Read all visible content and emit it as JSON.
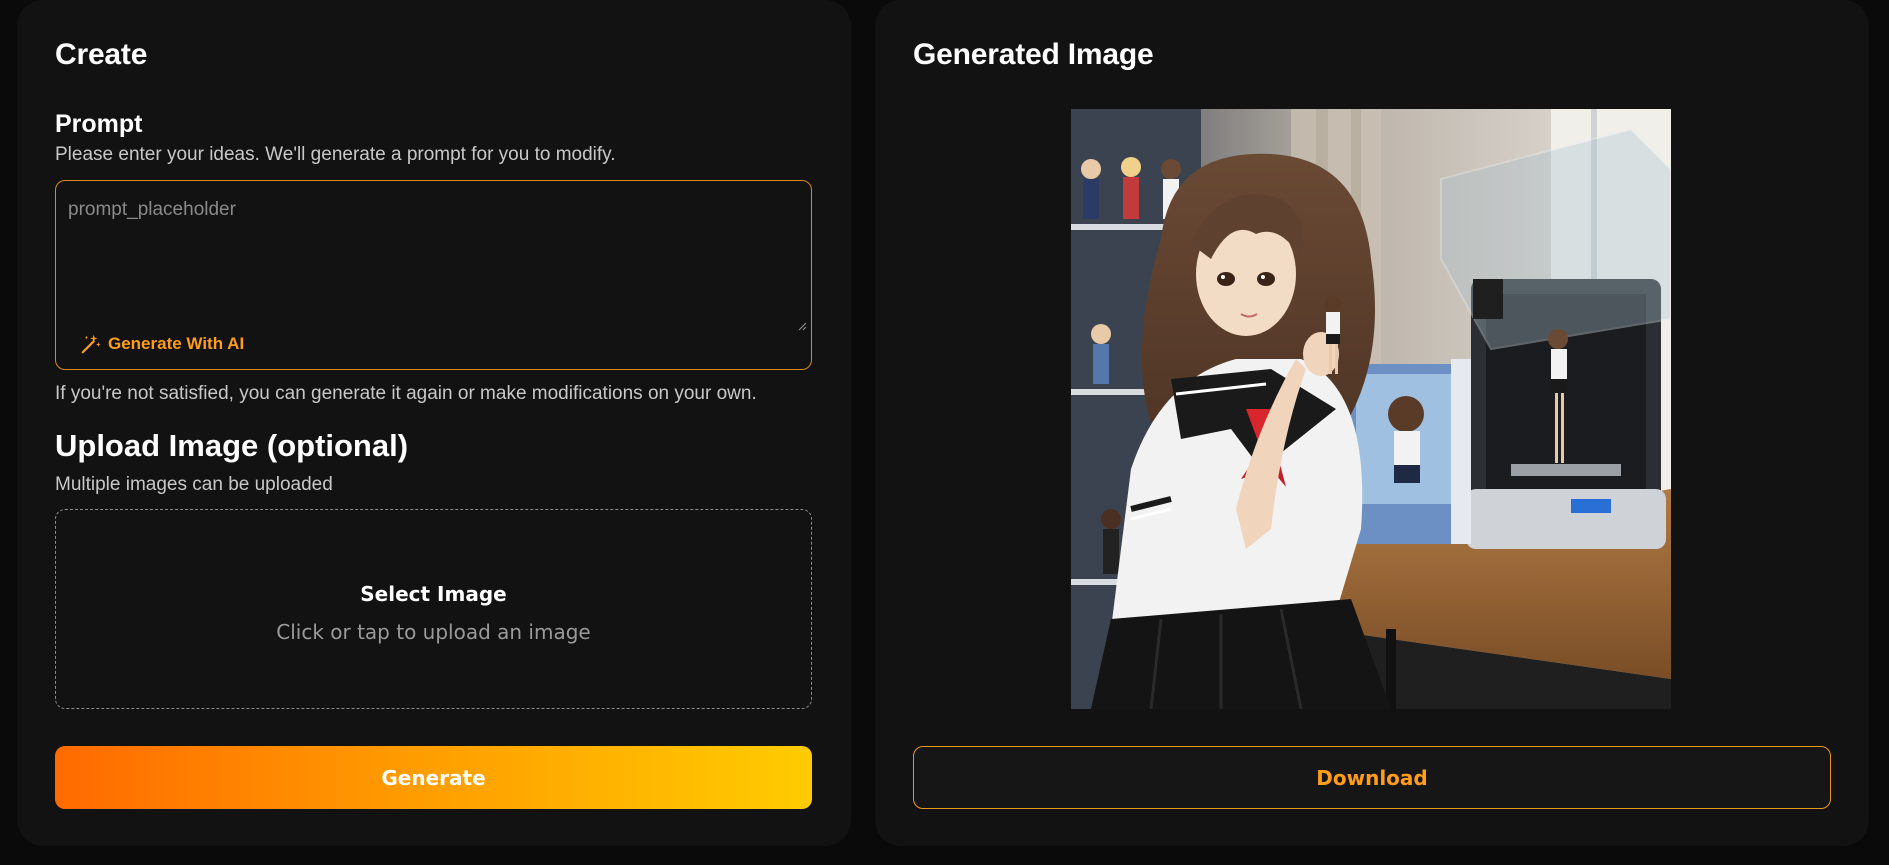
{
  "create_panel": {
    "title": "Create",
    "prompt": {
      "title": "Prompt",
      "hint": "Please enter your ideas. We'll generate a prompt for you to modify.",
      "placeholder": "prompt_placeholder",
      "value": "",
      "ai_button_label": "Generate With AI",
      "ai_button_icon": "magic-wand-icon",
      "after_hint": "If you're not satisfied, you can generate it again or make modifications on your own."
    },
    "upload": {
      "title": "Upload Image (optional)",
      "hint": "Multiple images can be uploaded",
      "select_label": "Select Image",
      "select_sub": "Click or tap to upload an image"
    },
    "generate_label": "Generate"
  },
  "result_panel": {
    "title": "Generated Image",
    "download_label": "Download"
  },
  "colors": {
    "accent": "#ff9d1a",
    "panel_bg": "#121212",
    "page_bg": "#0a0a0a",
    "gradient_start": "#ff6a00",
    "gradient_end": "#ffcc00"
  }
}
